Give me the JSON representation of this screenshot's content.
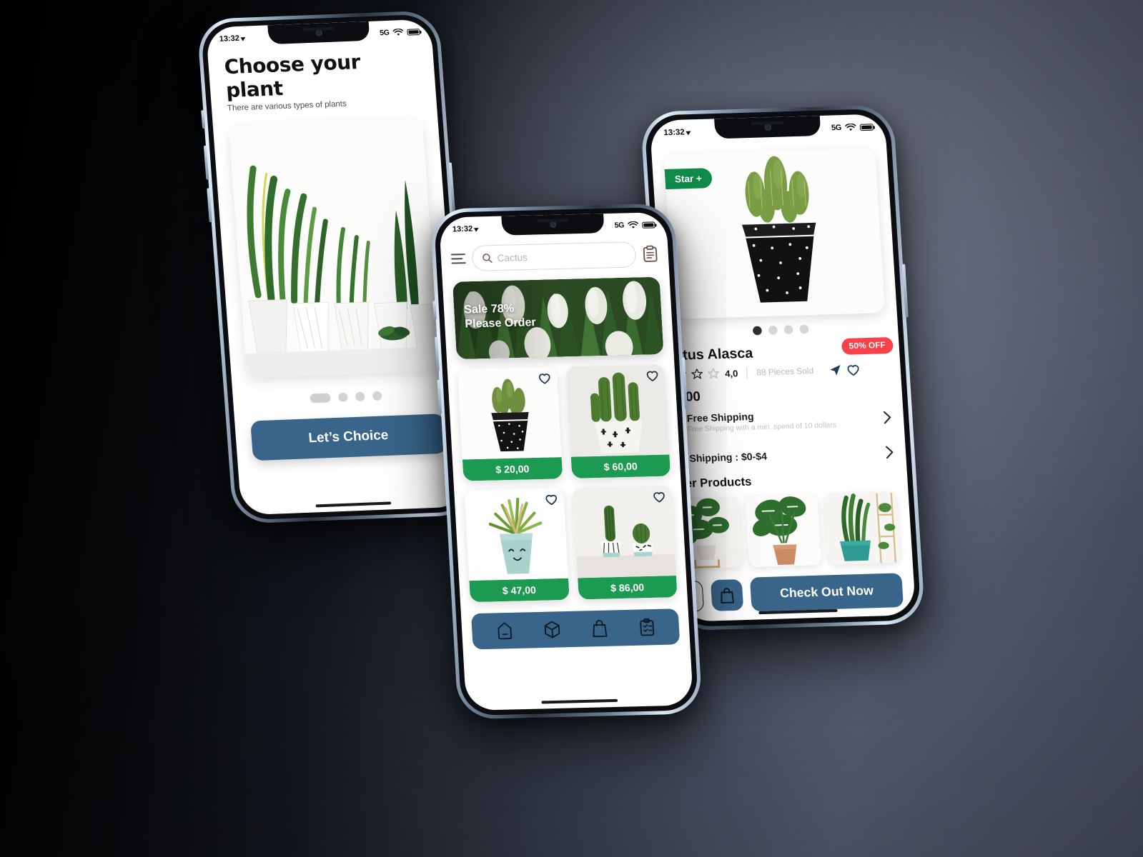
{
  "background": {
    "dark": "#050608",
    "light": "#6d7382"
  },
  "colors": {
    "accent_blue": "#39658a",
    "price_green": "#1d9a52",
    "badge_red": "#f9414a",
    "star_green": "#0f8a4a"
  },
  "status_bar": {
    "time": "13:32",
    "network": "5G",
    "wifi_icon": "wifi-icon",
    "battery_icon": "battery-icon",
    "location_icon": "location-arrow-icon"
  },
  "screen_onboarding": {
    "title": "Choose your plant",
    "subtitle": "There are various types of plants",
    "hero_image_alt": "snake-plants-in-white-pots",
    "pagination": {
      "count": 4,
      "active_index": 0
    },
    "cta_label": "Let’s Choice"
  },
  "screen_home": {
    "menu_icon": "hamburger-menu-icon",
    "search": {
      "placeholder": "Cactus",
      "value": "",
      "icon": "search-icon"
    },
    "notes_icon": "clipboard-icon",
    "banner": {
      "line1": "Sale 78%",
      "line2": "Please Order",
      "image_alt": "white-tulips"
    },
    "products": [
      {
        "price": "$ 20,00",
        "image_alt": "cactus-in-black-dotted-pot",
        "favorite_icon": "heart-icon"
      },
      {
        "price": "$ 60,00",
        "image_alt": "tall-cactus-in-cactus-print-pot",
        "favorite_icon": "heart-icon"
      },
      {
        "price": "$ 47,00",
        "image_alt": "plant-in-smiley-face-pot",
        "favorite_icon": "heart-icon"
      },
      {
        "price": "$ 86,00",
        "image_alt": "two-small-cacti-in-pots",
        "favorite_icon": "heart-icon"
      }
    ],
    "nav_items": [
      {
        "name": "home-icon"
      },
      {
        "name": "box-icon"
      },
      {
        "name": "bag-icon"
      },
      {
        "name": "clipboard-checklist-icon"
      }
    ]
  },
  "screen_detail": {
    "star_badge": "Star +",
    "product_image_alt": "cactus-in-black-dotted-pot",
    "gallery": {
      "count": 4,
      "active_index": 0
    },
    "product_name": "Cactus Alasca",
    "discount_badge": "50% OFF",
    "rating": {
      "value": "4,0",
      "stars": 4,
      "max": 5
    },
    "sold": "88 Pieces Sold",
    "share_icon": "share-arrow-icon",
    "favorite_icon": "heart-icon",
    "price": "$10,00",
    "shipping": [
      {
        "icon": "truck-icon",
        "title": "Free Shipping",
        "subtitle": "Free Shipping with a min. spend of 10 dollars",
        "chevron": "chevron-right-icon"
      },
      {
        "icon": "truck-icon",
        "title": "Shipping : $0-$4",
        "subtitle": "",
        "chevron": "chevron-right-icon"
      }
    ],
    "other_products_title": "Other Products",
    "other_products": [
      {
        "image_alt": "monstera-on-wooden-stand"
      },
      {
        "image_alt": "monstera-in-terracotta-pot"
      },
      {
        "image_alt": "snake-plant-in-teal-pot"
      }
    ],
    "chat_icon": "chat-icon",
    "bag_icon": "bag-icon",
    "checkout_label": "Check Out Now"
  }
}
